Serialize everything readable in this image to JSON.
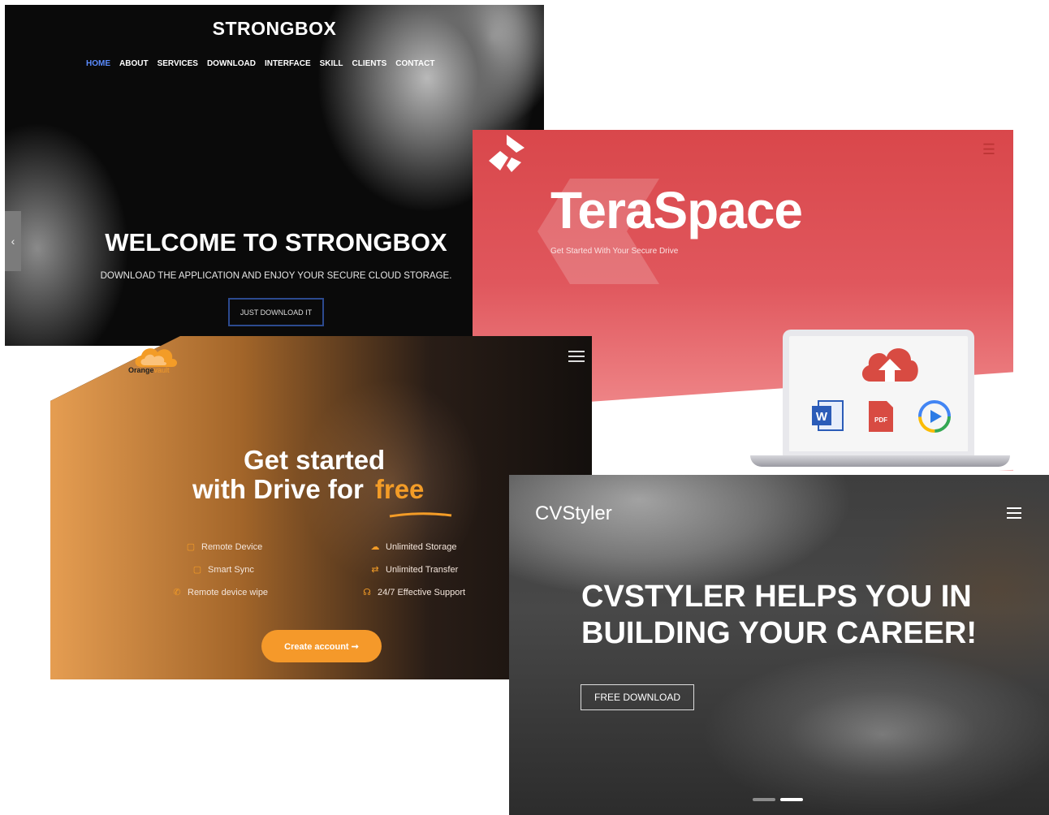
{
  "strongbox": {
    "title": "STRONGBOX",
    "nav": [
      "HOME",
      "ABOUT",
      "SERVICES",
      "DOWNLOAD",
      "INTERFACE",
      "SKILL",
      "CLIENTS",
      "CONTACT"
    ],
    "active_nav": "HOME",
    "arrow": "‹",
    "heading": "WELCOME TO STRONGBOX",
    "subheading": "DOWNLOAD THE APPLICATION AND ENJOY YOUR SECURE CLOUD STORAGE.",
    "button": "JUST DOWNLOAD IT",
    "colors": {
      "accent": "#5b8cff",
      "button_border": "#2c4a8f"
    }
  },
  "teraspace": {
    "title": "TeraSpace",
    "subtitle": "Get Started With Your Secure Drive",
    "menu_icon": "☰",
    "icons": [
      "logo-icon",
      "upload-cloud-icon",
      "word-file-icon",
      "pdf-file-icon",
      "play-icon"
    ],
    "pdf_label": "PDF",
    "word_label": "W",
    "colors": {
      "brand": "#d9474b",
      "word": "#2b5cb8",
      "pdf": "#d84b42"
    }
  },
  "orangevault": {
    "brand_main": "Orange",
    "brand_accent": "vault",
    "heading_line1": "Get started",
    "heading_line2": "with Drive for",
    "heading_accent": "free",
    "features": [
      {
        "icon": "▢",
        "label": "Remote Device"
      },
      {
        "icon": "☁",
        "label": "Unlimited Storage"
      },
      {
        "icon": "▢",
        "label": "Smart Sync"
      },
      {
        "icon": "⇄",
        "label": "Unlimited Transfer"
      },
      {
        "icon": "✆",
        "label": "Remote device wipe"
      },
      {
        "icon": "☊",
        "label": "24/7 Effective Support"
      }
    ],
    "button": "Create account ➞",
    "colors": {
      "accent": "#f39c27"
    }
  },
  "cvstyler": {
    "brand": "CVStyler",
    "heading_line1": "CVSTYLER HELPS YOU IN",
    "heading_line2": "BUILDING YOUR CAREER!",
    "button": "FREE DOWNLOAD"
  }
}
